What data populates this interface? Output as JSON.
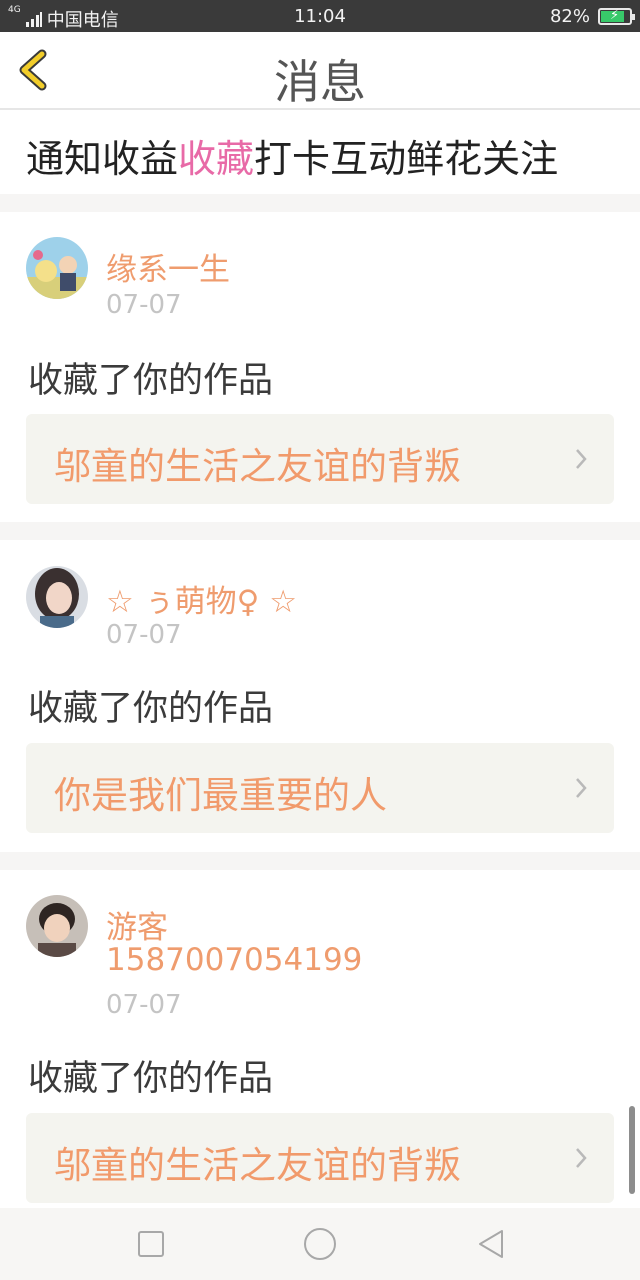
{
  "status_bar": {
    "carrier": "中国电信",
    "network": "4G",
    "time": "11:04",
    "battery_text": "82%",
    "battery_level": 0.82
  },
  "header": {
    "title": "消息"
  },
  "tabs": [
    {
      "label": "通知"
    },
    {
      "label": "收益"
    },
    {
      "label": "收藏",
      "active": true
    },
    {
      "label": "打卡"
    },
    {
      "label": "互动"
    },
    {
      "label": "鲜花"
    },
    {
      "label": "关注"
    }
  ],
  "messages": [
    {
      "user": "缘系一生",
      "date": "07-07",
      "action": "收藏了你的作品",
      "work_title": "邬童的生活之友谊的背叛"
    },
    {
      "user": "☆ ぅ萌物♀ ☆",
      "date": "07-07",
      "action": "收藏了你的作品",
      "work_title": "你是我们最重要的人"
    },
    {
      "user": "游客",
      "user_id": "1587007054199",
      "date": "07-07",
      "action": "收藏了你的作品",
      "work_title": "邬童的生活之友谊的背叛"
    }
  ],
  "colors": {
    "accent_pink": "#e86aa7",
    "username_orange": "#ef9c6e",
    "work_title_orange": "#f19a6b",
    "status_bar_bg": "#3a3a3a",
    "battery_green": "#38c96a"
  },
  "icons": [
    "signal-icon",
    "battery-icon",
    "back-chevron-icon",
    "avatar",
    "chevron-right-icon",
    "nav-recent-icon",
    "nav-home-icon",
    "nav-back-icon"
  ]
}
